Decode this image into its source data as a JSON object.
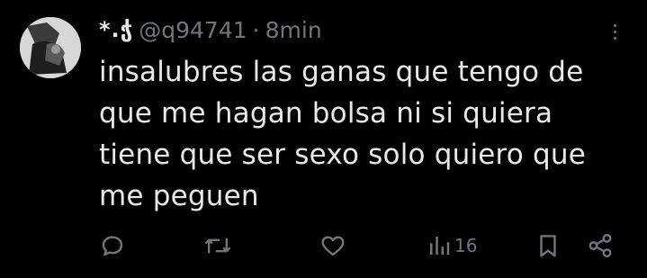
{
  "tweet": {
    "display_name": "*.ჭ",
    "handle": "@q94741",
    "separator": "·",
    "time": "8min",
    "text_lines": [
      "insalubres las ganas que tengo de",
      "que me hagan bolsa ni si quiera",
      "tiene que ser sexo solo quiero que",
      "me peguen"
    ],
    "views_count": "16"
  },
  "icons": {
    "avatar": "avatar-photo",
    "more": "more-icon",
    "reply": "reply-icon",
    "retweet": "retweet-icon",
    "like": "like-icon",
    "views": "views-icon",
    "bookmark": "bookmark-icon",
    "share": "share-icon"
  },
  "colors": {
    "background": "#000000",
    "text": "#e7e9ea",
    "muted": "#71767b"
  }
}
